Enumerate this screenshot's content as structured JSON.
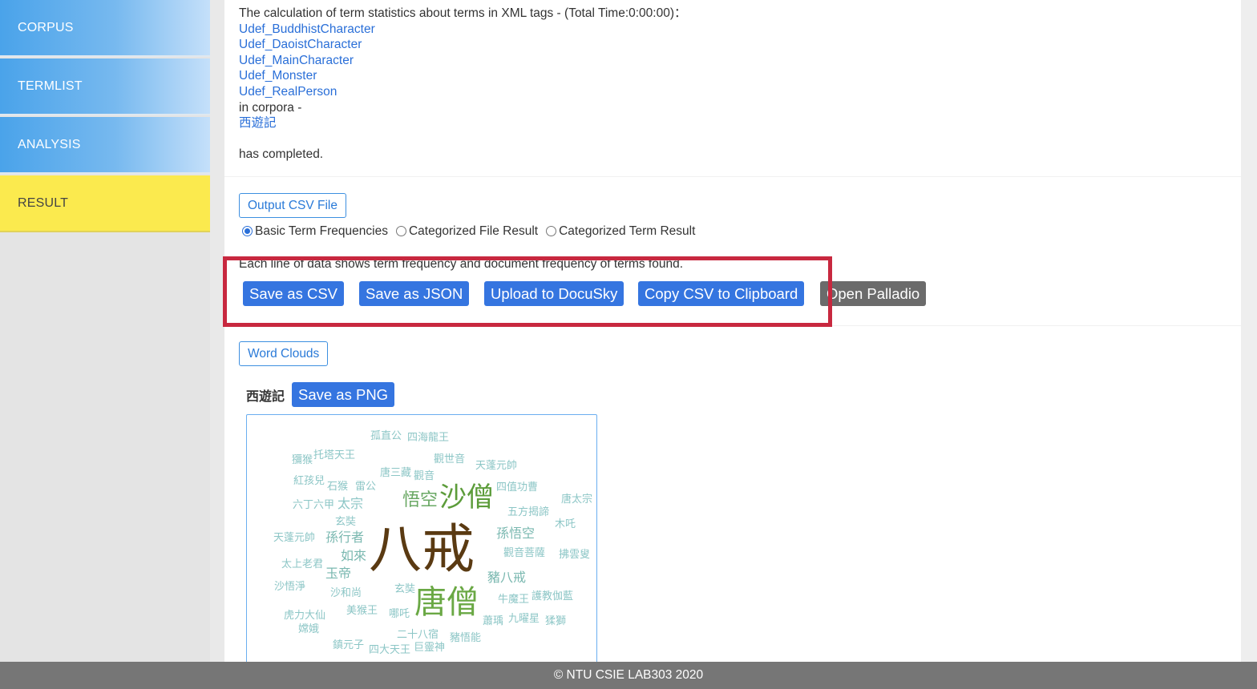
{
  "sidebar": {
    "items": [
      {
        "label": "CORPUS"
      },
      {
        "label": "TERMLIST"
      },
      {
        "label": "ANALYSIS"
      },
      {
        "label": "RESULT"
      }
    ]
  },
  "notice": {
    "intro": "The calculation of term statistics about terms in XML tags - (Total Time:0:00:00)：",
    "tags": [
      "Udef_BuddhistCharacter",
      "Udef_DaoistCharacter",
      "Udef_MainCharacter",
      "Udef_Monster",
      "Udef_RealPerson"
    ],
    "in_corpora": "in corpora -",
    "corpus_link": "西遊記",
    "completed": "has completed."
  },
  "output": {
    "button_label": "Output CSV File",
    "radios": [
      {
        "label": "Basic Term Frequencies",
        "checked": true
      },
      {
        "label": "Categorized File Result",
        "checked": false
      },
      {
        "label": "Categorized Term Result",
        "checked": false
      }
    ],
    "description": "Each line of data shows term frequency and document frequency of terms found.",
    "actions": [
      {
        "label": "Save as CSV"
      },
      {
        "label": "Save as JSON"
      },
      {
        "label": "Upload to DocuSky"
      },
      {
        "label": "Copy CSV to Clipboard"
      },
      {
        "label": "Open Palladio"
      }
    ]
  },
  "word_clouds": {
    "button_label": "Word Clouds",
    "corpus_label": "西遊記",
    "save_png": "Save as PNG",
    "words": [
      {
        "text": "孤直公",
        "color": "#8cc6c6"
      },
      {
        "text": "四海龍王",
        "color": "#8cc6c6"
      },
      {
        "text": "獼猴",
        "color": "#8cc6c6"
      },
      {
        "text": "托塔天王",
        "color": "#8cc6c6"
      },
      {
        "text": "觀世音",
        "color": "#8cc6c6"
      },
      {
        "text": "天蓬元帥",
        "color": "#8cc6c6"
      },
      {
        "text": "唐三藏",
        "color": "#8cc6c6"
      },
      {
        "text": "觀音",
        "color": "#8cc6c6"
      },
      {
        "text": "紅孩兒",
        "color": "#8cc6c6"
      },
      {
        "text": "石猴",
        "color": "#8cc6c6"
      },
      {
        "text": "雷公",
        "color": "#8cc6c6"
      },
      {
        "text": "四值功曹",
        "color": "#8cc6c6"
      },
      {
        "text": "悟空",
        "color": "#6aa864"
      },
      {
        "text": "沙僧",
        "color": "#5c9c3a"
      },
      {
        "text": "唐太宗",
        "color": "#8cc6c6"
      },
      {
        "text": "六丁六甲",
        "color": "#8cc6c6"
      },
      {
        "text": "太宗",
        "color": "#8cc6c6"
      },
      {
        "text": "五方揭諦",
        "color": "#8cc6c6"
      },
      {
        "text": "玄奘",
        "color": "#8cc6c6"
      },
      {
        "text": "木吒",
        "color": "#8cc6c6"
      },
      {
        "text": "天蓬元帥",
        "color": "#8cc6c6"
      },
      {
        "text": "孫行者",
        "color": "#7ab8b0"
      },
      {
        "text": "八戒",
        "color": "#5a3a12"
      },
      {
        "text": "孫悟空",
        "color": "#7ab8b0"
      },
      {
        "text": "如來",
        "color": "#7ab8b0"
      },
      {
        "text": "觀音菩薩",
        "color": "#8cc6c6"
      },
      {
        "text": "拂雲叟",
        "color": "#8cc6c6"
      },
      {
        "text": "太上老君",
        "color": "#8cc6c6"
      },
      {
        "text": "玉帝",
        "color": "#7ab8b0"
      },
      {
        "text": "豬八戒",
        "color": "#7ab8b0"
      },
      {
        "text": "沙悟淨",
        "color": "#8cc6c6"
      },
      {
        "text": "沙和尚",
        "color": "#8cc6c6"
      },
      {
        "text": "玄奘",
        "color": "#8cc6c6"
      },
      {
        "text": "唐僧",
        "color": "#6aa844"
      },
      {
        "text": "牛魔王",
        "color": "#8cc6c6"
      },
      {
        "text": "護教伽藍",
        "color": "#8cc6c6"
      },
      {
        "text": "虎力大仙",
        "color": "#8cc6c6"
      },
      {
        "text": "美猴王",
        "color": "#8cc6c6"
      },
      {
        "text": "哪吒",
        "color": "#8cc6c6"
      },
      {
        "text": "蕭瑀",
        "color": "#8cc6c6"
      },
      {
        "text": "九曜星",
        "color": "#8cc6c6"
      },
      {
        "text": "猱獅",
        "color": "#8cc6c6"
      },
      {
        "text": "嫦娥",
        "color": "#8cc6c6"
      },
      {
        "text": "二十八宿",
        "color": "#8cc6c6"
      },
      {
        "text": "豬悟能",
        "color": "#8cc6c6"
      },
      {
        "text": "鎮元子",
        "color": "#8cc6c6"
      },
      {
        "text": "四大天王",
        "color": "#8cc6c6"
      },
      {
        "text": "巨靈神",
        "color": "#8cc6c6"
      }
    ]
  },
  "footer": {
    "text": "© NTU CSIE LAB303 2020"
  }
}
